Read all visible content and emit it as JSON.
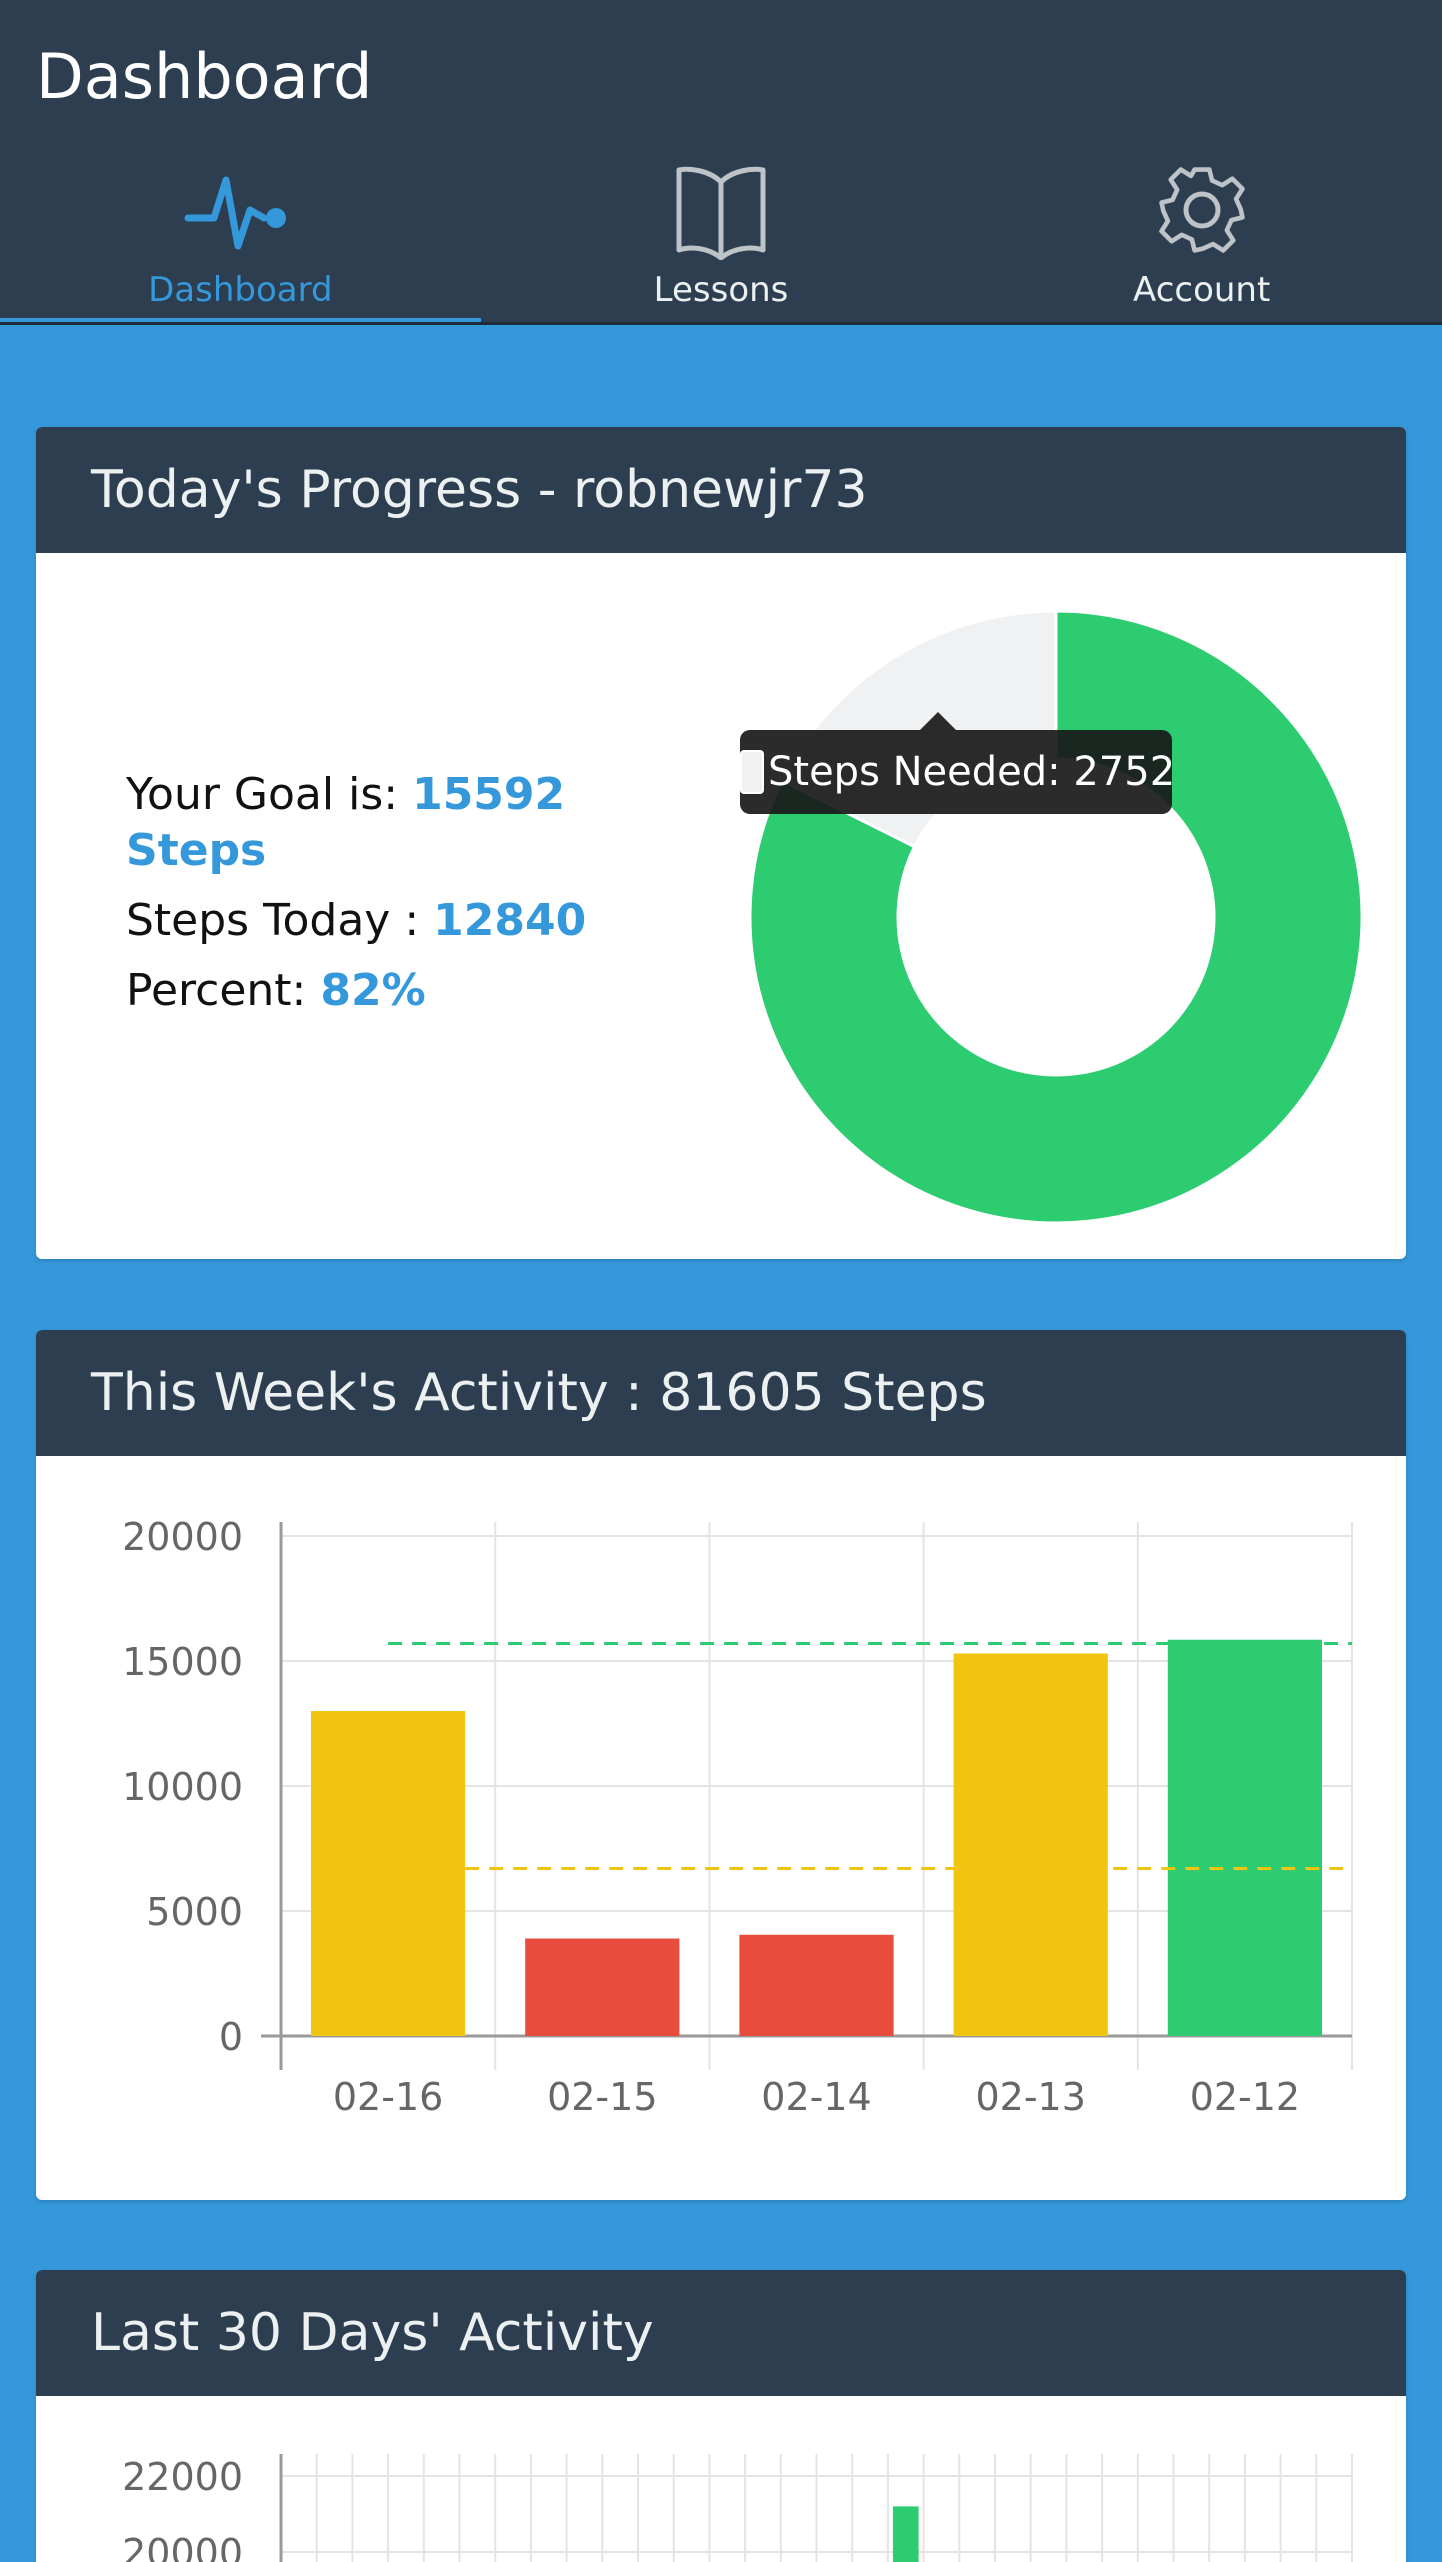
{
  "app": {
    "title": "Dashboard"
  },
  "tabs": [
    {
      "label": "Dashboard",
      "icon": "pulse-icon",
      "active": true
    },
    {
      "label": "Lessons",
      "icon": "book-icon",
      "active": false
    },
    {
      "label": "Account",
      "icon": "gear-icon",
      "active": false
    }
  ],
  "colors": {
    "header": "#2c3e50",
    "accent": "#3498db",
    "green": "#2ecc71",
    "yellow": "#f1c40f",
    "red": "#e74c3c",
    "remaining": "#f0f1f2"
  },
  "progress": {
    "title": "Today's Progress - robnewjr73",
    "goal_label": "Your Goal is: ",
    "goal_value": "15592 Steps",
    "today_label": "Steps Today : ",
    "today_value": "12840",
    "percent_label": "Percent: ",
    "percent_value": "82%",
    "tooltip": "Steps Needed: 2752"
  },
  "week": {
    "title": "This Week's Activity : 81605 Steps"
  },
  "month": {
    "title": "Last 30 Days' Activity"
  },
  "chart_data": [
    {
      "type": "pie",
      "variant": "doughnut",
      "categories": [
        "Steps Today",
        "Steps Needed"
      ],
      "values": [
        12840,
        2752
      ],
      "colors": [
        "#2ecc71",
        "#f0f1f2"
      ]
    },
    {
      "type": "bar",
      "categories": [
        "02-16",
        "02-15",
        "02-14",
        "02-13",
        "02-12"
      ],
      "values": [
        13000,
        3900,
        4050,
        15300,
        15850
      ],
      "bar_colors": [
        "#f1c40f",
        "#e74c3c",
        "#e74c3c",
        "#f1c40f",
        "#2ecc71"
      ],
      "reference_lines": [
        {
          "value": 15700,
          "color": "#2ecc71"
        },
        {
          "value": 6700,
          "color": "#f1c40f"
        }
      ],
      "ylim": [
        0,
        20000
      ],
      "yticks": [
        0,
        5000,
        10000,
        15000,
        20000
      ],
      "grid": true
    },
    {
      "type": "bar",
      "ylim": [
        20000,
        22000
      ],
      "yticks": [
        20000,
        22000
      ],
      "visible_bar": {
        "value": 21200,
        "color": "#2ecc71"
      },
      "grid": true
    }
  ]
}
